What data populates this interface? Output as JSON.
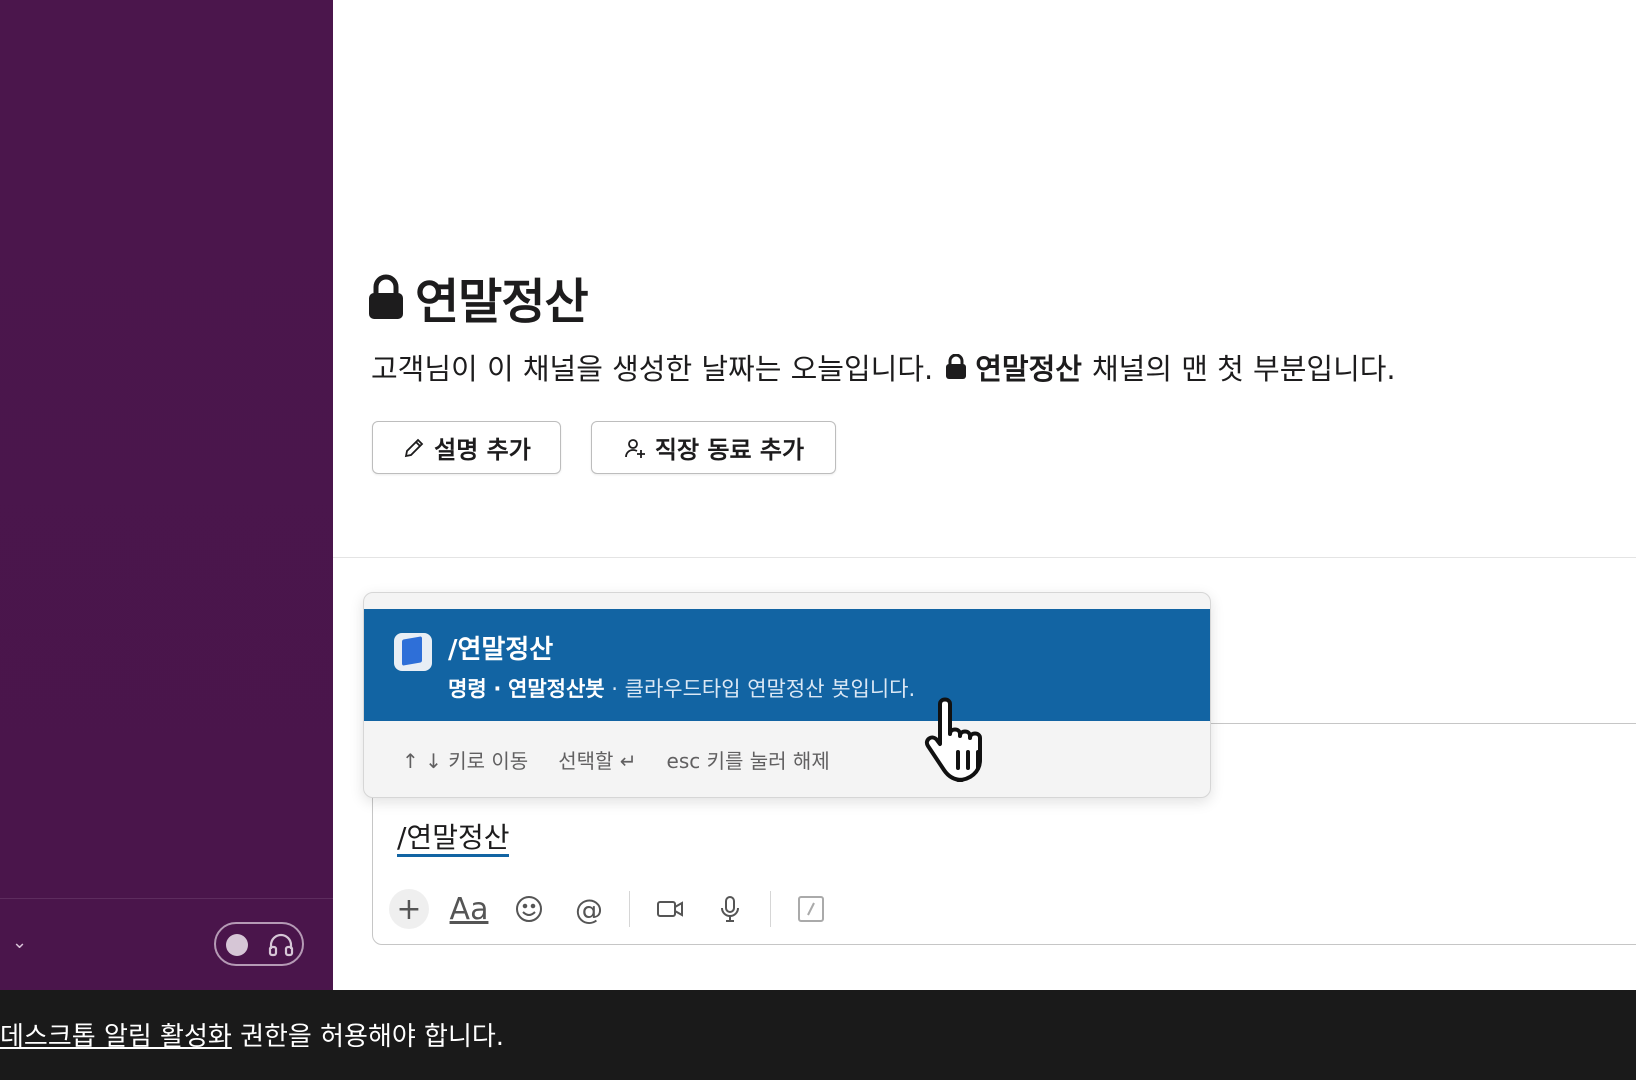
{
  "channel": {
    "name": "연말정산",
    "intro_prefix": "고객님이 이 채널을 생성한 날짜는 오늘입니다.",
    "intro_channel": "연말정산",
    "intro_suffix": "채널의 맨 첫 부분입니다."
  },
  "actions": {
    "add_description": "설명 추가",
    "add_coworkers": "직장 동료 추가"
  },
  "autocomplete": {
    "command": "/연말정산",
    "meta_type": "명령",
    "meta_sep": "·",
    "meta_bot": "연말정산봇",
    "meta_desc": "· 클라우드타입 연말정산 봇입니다.",
    "hint_nav": "↑ ↓ 키로 이동",
    "hint_select": "선택할 ↵",
    "hint_dismiss": "esc 키를 눌러 해제"
  },
  "composer": {
    "text": "/연말정산",
    "toolbar": {
      "plus": "+",
      "format": "Aa",
      "emoji": "☺",
      "mention": "@"
    }
  },
  "sidebar": {
    "chevron": "⌄"
  },
  "notification": {
    "link": "데스크톱 알림 활성화",
    "rest": " 권한을 허용해야 합니다."
  },
  "colors": {
    "sidebar": "#4a154b",
    "highlight": "#1264a3",
    "notification_bar": "#1a1a1a"
  }
}
